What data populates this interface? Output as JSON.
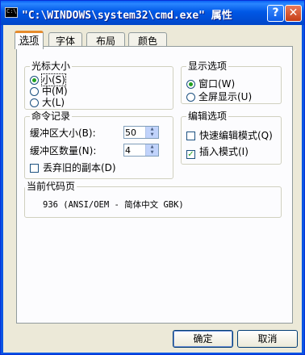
{
  "window": {
    "title": "\"C:\\WINDOWS\\system32\\cmd.exe\" 属性",
    "help_label": "?",
    "close_label": "✕"
  },
  "tabs": [
    {
      "label": "选项",
      "active": true
    },
    {
      "label": "字体",
      "active": false
    },
    {
      "label": "布局",
      "active": false
    },
    {
      "label": "颜色",
      "active": false
    }
  ],
  "cursor_size": {
    "title": "光标大小",
    "options": [
      {
        "label": "小(S)",
        "selected": true
      },
      {
        "label": "中(M)",
        "selected": false
      },
      {
        "label": "大(L)",
        "selected": false
      }
    ]
  },
  "display_options": {
    "title": "显示选项",
    "options": [
      {
        "label": "窗口(W)",
        "selected": true
      },
      {
        "label": "全屏显示(U)",
        "selected": false
      }
    ]
  },
  "command_history": {
    "title": "命令记录",
    "buffer_size_label": "缓冲区大小(B):",
    "buffer_size_value": "50",
    "buffer_count_label": "缓冲区数量(N):",
    "buffer_count_value": "4",
    "discard_label": "丢弃旧的副本(D)",
    "discard_checked": false
  },
  "edit_options": {
    "title": "编辑选项",
    "quick_edit_label": "快速编辑模式(Q)",
    "quick_edit_checked": false,
    "insert_mode_label": "插入模式(I)",
    "insert_mode_checked": true
  },
  "code_page": {
    "title": "当前代码页",
    "value": "936   (ANSI/OEM - 简体中文 GBK)"
  },
  "buttons": {
    "ok": "确定",
    "cancel": "取消"
  },
  "colors": {
    "title_bar": "#0058e6",
    "dialog_bg": "#ece9d8",
    "tab_accent": "#e68b2c",
    "check_green": "#21a121"
  }
}
